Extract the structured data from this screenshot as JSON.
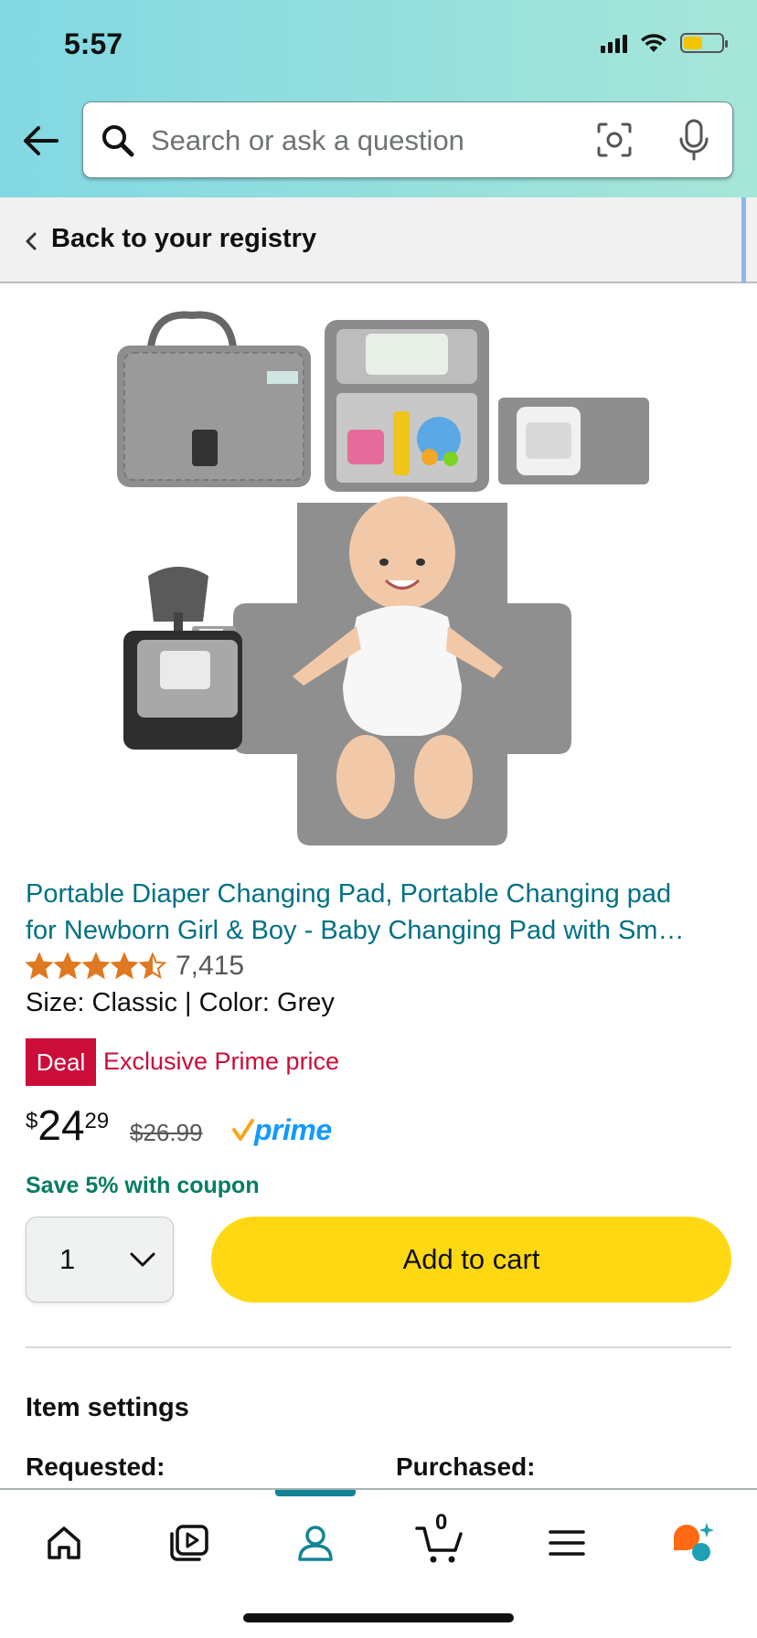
{
  "status_bar": {
    "time": "5:57"
  },
  "search": {
    "placeholder": "Search or ask a question"
  },
  "registry": {
    "back_label": "Back to your registry"
  },
  "product": {
    "image_alt": "Portable diaper changing pad with baby",
    "title_line1": "Portable Diaper Changing Pad, Portable Changing pad",
    "title_line2": "for Newborn Girl & Boy - Baby Changing Pad with Sm…",
    "rating": 4.5,
    "rating_count": "7,415",
    "variant": "Size: Classic | Color: Grey",
    "deal_badge": "Deal",
    "deal_text": "Exclusive Prime price",
    "price_symbol": "$",
    "price_whole": "24",
    "price_fraction": "29",
    "list_price": "$26.99",
    "prime_label": "prime",
    "coupon": "Save 5% with coupon"
  },
  "purchase": {
    "quantity": "1",
    "add_to_cart_label": "Add to cart"
  },
  "settings": {
    "title": "Item settings",
    "requested_label": "Requested:",
    "purchased_label": "Purchased:"
  },
  "tabbar": {
    "active": "account",
    "cart_count": "0",
    "items": [
      "home-icon",
      "video-icon",
      "account-icon",
      "cart-icon",
      "menu-icon",
      "rufus-icon"
    ]
  },
  "colors": {
    "link": "#007185",
    "deal": "#cc0c39",
    "add_to_cart": "#ffd814",
    "coupon": "#067d62",
    "prime": "#1399ff",
    "accent": "#138496"
  }
}
